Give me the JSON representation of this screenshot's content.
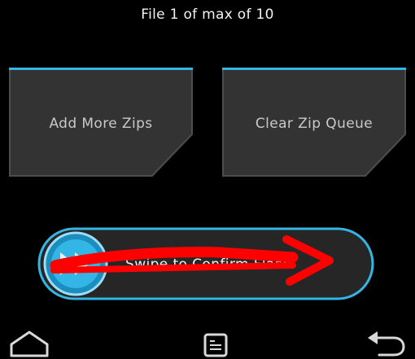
{
  "header": {
    "status": "File 1 of max of 10"
  },
  "buttons": {
    "add_more_zips": "Add More Zips",
    "clear_zip_queue": "Clear Zip Queue"
  },
  "swipe": {
    "label": "Swipe to Confirm Flash"
  },
  "nav": {
    "home_icon": "home-icon",
    "log_icon": "console-log-icon",
    "back_icon": "back-arrow-icon"
  },
  "colors": {
    "accent": "#33b5e5",
    "tile_fill": "#333333",
    "tile_border": "#555555",
    "annotation": "#ff0000"
  }
}
